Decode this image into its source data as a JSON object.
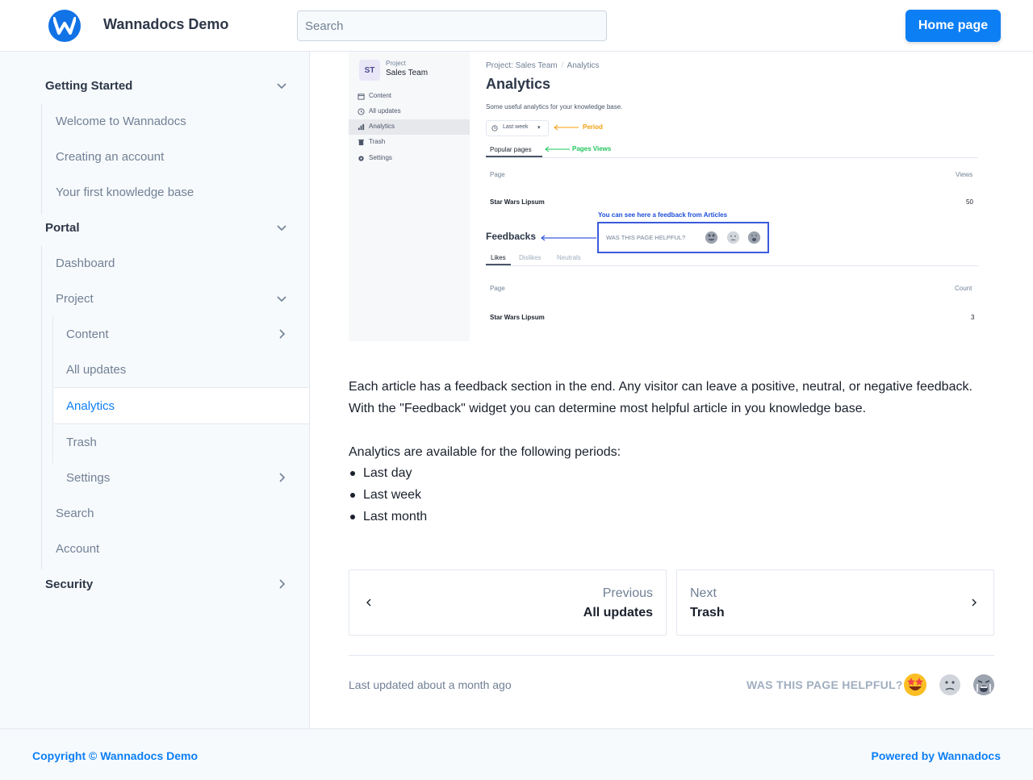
{
  "header": {
    "brand": "Wannadocs Demo",
    "search_placeholder": "Search",
    "home_button": "Home page",
    "accent_color": "#0d7ff5"
  },
  "sidebar": {
    "getting_started": "Getting Started",
    "welcome": "Welcome to Wannadocs",
    "creating_account": "Creating an account",
    "first_kb": "Your first knowledge base",
    "portal": "Portal",
    "dashboard": "Dashboard",
    "project": "Project",
    "content": "Content",
    "all_updates": "All updates",
    "analytics": "Analytics",
    "trash": "Trash",
    "settings": "Settings",
    "search": "Search",
    "account": "Account",
    "security": "Security"
  },
  "screenshot": {
    "badge": "ST",
    "project_caption": "Project",
    "project_name": "Sales Team",
    "menu": [
      "Content",
      "All updates",
      "Analytics",
      "Trash",
      "Settings"
    ],
    "breadcrumb_project": "Project: Sales Team",
    "breadcrumb_sep": "/",
    "breadcrumb_page": "Analytics",
    "title": "Analytics",
    "subtitle": "Some useful analytics for your knowledge base.",
    "period_select": "Last week",
    "period_note": "Period",
    "tab_popular": "Popular pages",
    "views_note": "Pages Views",
    "col_page": "Page",
    "col_views": "Views",
    "row1_page": "Star Wars Lipsum",
    "row1_views": "50",
    "feedback_note": "You can see here a feedback from Articles",
    "feedbacks_title": "Feedbacks",
    "helpful_question": "WAS THIS PAGE HELPFUL?",
    "tab_likes": "Likes",
    "tab_dislikes": "Dislikes",
    "tab_neutrals": "Neutrals",
    "col_page2": "Page",
    "col_count": "Count",
    "row2_page": "Star Wars Lipsum",
    "row2_count": "3"
  },
  "article": {
    "para1_line1": "Each article has a feedback section in the end. Any visitor can leave a positive, neutral, or negative feedback.",
    "para1_line2": "With the \"Feedback\" widget you can determine most helpful article in you knowledge base.",
    "para2": "Analytics are available for the following periods:",
    "periods": [
      "Last day",
      "Last week",
      "Last month"
    ]
  },
  "pager": {
    "prev_label": "Previous",
    "prev_title": "All updates",
    "next_label": "Next",
    "next_title": "Trash"
  },
  "meta": {
    "last_updated": "Last updated about a month ago",
    "helpful_question": "WAS THIS PAGE HELPFUL?"
  },
  "footer": {
    "copyright": "Copyright © Wannadocs Demo",
    "powered": "Powered by Wannadocs"
  }
}
